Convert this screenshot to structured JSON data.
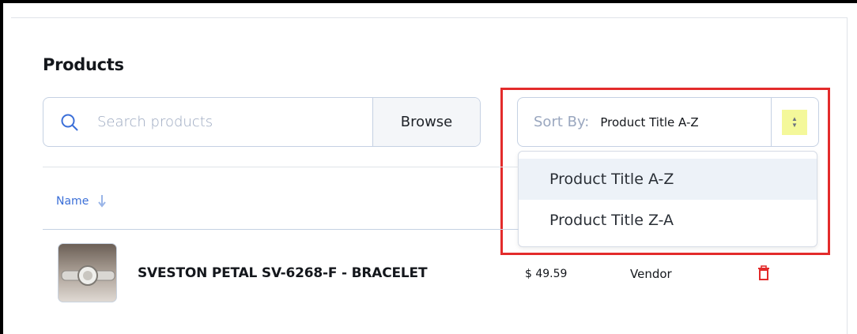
{
  "page": {
    "title": "Products"
  },
  "search": {
    "placeholder": "Search products",
    "browse_label": "Browse"
  },
  "sort": {
    "label": "Sort By:",
    "value": "Product Title A-Z",
    "options": [
      {
        "label": "Product Title A-Z",
        "selected": true
      },
      {
        "label": "Product Title Z-A",
        "selected": false
      }
    ]
  },
  "table": {
    "columns": {
      "name": "Name"
    },
    "rows": [
      {
        "name": "SVESTON PETAL SV-6268-F - BRACELET",
        "price": "$ 49.59",
        "vendor": "Vendor"
      }
    ]
  },
  "colors": {
    "accent": "#3b6fd8",
    "highlight_outline": "#e32b2b",
    "delete_icon": "#e32b2b",
    "arrows_bg": "#f4f89a"
  },
  "icons": {
    "search": "search-icon",
    "sort": "sort-arrows-icon",
    "column_sort": "arrow-down-icon",
    "delete": "trash-icon"
  }
}
